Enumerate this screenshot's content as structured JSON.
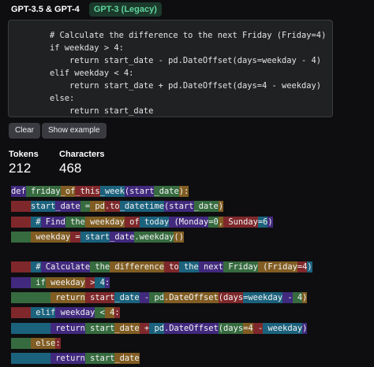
{
  "model_tabs": [
    {
      "label": "GPT-3.5 & GPT-4",
      "active": true
    },
    {
      "label": "GPT-3 (Legacy)",
      "active": false
    }
  ],
  "input_lines": [
    "# Calculate the difference to the next Friday (Friday=4)",
    "if weekday > 4:",
    "    return start_date - pd.DateOffset(days=weekday - 4)",
    "elif weekday < 4:",
    "    return start_date + pd.DateOffset(days=4 - weekday)",
    "else:",
    "    return start_date"
  ],
  "buttons": {
    "clear": "Clear",
    "show_example": "Show example"
  },
  "stats": {
    "tokens_label": "Tokens",
    "tokens_value": "212",
    "characters_label": "Characters",
    "characters_value": "468"
  },
  "colors": {
    "token_palette": [
      "#6b40d8",
      "#68de7a",
      "#f4ac36",
      "#ef4146",
      "#27b5ea"
    ],
    "legacy_tab_text": "#5fd39b"
  },
  "token_lines": [
    [
      "def",
      " friday",
      "_of",
      "_this",
      "_week",
      "(start",
      "_date",
      "):"
    ],
    [
      "    ",
      "start",
      "_date",
      " =",
      " pd",
      ".to",
      "_datetime",
      "(start",
      "_date",
      ")"
    ],
    [
      "    ",
      " #",
      " Find",
      " the",
      " weekday",
      " of",
      " today",
      " (Monday",
      "=0",
      ",",
      " Sunday",
      "=6",
      ")"
    ],
    [
      "    ",
      " weekday",
      " =",
      " start",
      "_date",
      ".weekday",
      "()"
    ],
    [
      ""
    ],
    [
      "    ",
      " #",
      " Calculate",
      " the",
      " difference",
      " to",
      " the",
      " next",
      " Friday",
      " (Friday",
      "=4",
      ")"
    ],
    [
      "    ",
      " if",
      " weekday",
      " >",
      " 4",
      ":"
    ],
    [
      "        ",
      " return",
      " start",
      "_date",
      " -",
      " pd",
      ".DateOffset",
      "(days",
      "=weekday",
      " -",
      " 4",
      ")"
    ],
    [
      "    ",
      " elif",
      " weekday",
      " <",
      " 4",
      ":"
    ],
    [
      "        ",
      " return",
      " start",
      "_date",
      " +",
      " pd",
      ".DateOffset",
      "(days",
      "=4",
      " -",
      " weekday",
      ")"
    ],
    [
      "    ",
      " else",
      ":"
    ],
    [
      "        ",
      " return",
      " start",
      "_date"
    ]
  ]
}
